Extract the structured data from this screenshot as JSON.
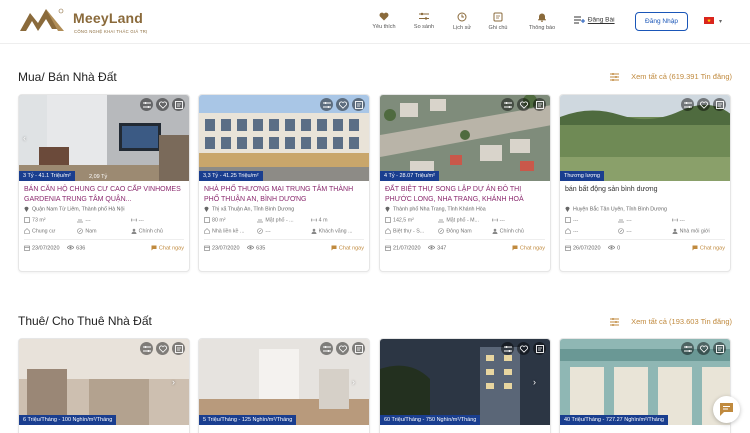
{
  "brand": {
    "name": "MeeyLand",
    "slogan": "CÔNG NGHỆ KHAI THÁC GIÁ TRỊ",
    "color": "#8a6a3b"
  },
  "nav": [
    {
      "label": "Yêu thích",
      "icon": "heart-icon"
    },
    {
      "label": "So sánh",
      "icon": "compare-icon"
    },
    {
      "label": "Lịch sử",
      "icon": "history-icon"
    },
    {
      "label": "Ghi chú",
      "icon": "note-icon"
    },
    {
      "label": "Thông báo",
      "icon": "bell-icon"
    }
  ],
  "header": {
    "post_label": "Đăng Bài",
    "login_label": "Đăng Nhập",
    "flag": "vn-flag-icon"
  },
  "sale": {
    "title": "Mua/ Bán Nhà Đất",
    "see_all": "Xem tất cả (619.391 Tin đăng)",
    "cards": [
      {
        "price": "3 Tỷ - 41.1 Triệu/m²",
        "price_extra": "2,09 Tỷ",
        "title": "BÁN CĂN HỘ CHUNG CƯ CAO CẤP VINHOMES GARDENIA TRUNG TÂM QUẬN...",
        "location": "Quận Nam Từ Liêm, Thành phố Hà Nội",
        "a1": "73 m²",
        "a2": "---",
        "a3": "---",
        "b1": "Chung cư",
        "b2": "Nam",
        "b3": "Chính chủ",
        "date": "23/07/2020",
        "views": "636",
        "chat": "Chat ngay"
      },
      {
        "price": "3,3 Tỷ - 41.25 Triệu/m²",
        "price_extra": "",
        "title": "NHÀ PHỐ THƯƠNG MẠI TRUNG TÂM THÀNH PHỐ THUẬN AN, BÌNH DƯƠNG",
        "location": "Thị xã Thuận An, Tỉnh Bình Dương",
        "a1": "80 m²",
        "a2": "Mặt phố - ...",
        "a3": "4 m",
        "b1": "Nhà liền kề ...",
        "b2": "---",
        "b3": "Khách vãng ...",
        "date": "23/07/2020",
        "views": "635",
        "chat": "Chat ngay"
      },
      {
        "price": "4 Tỷ - 28.07 Triệu/m²",
        "price_extra": "",
        "title": "ĐẤT BIỆT THỰ SONG LẬP DỰ ÁN ĐÔ THỊ PHƯỚC LONG, NHA TRANG, KHÁNH HOÀ",
        "location": "Thành phố Nha Trang, Tỉnh Khánh Hòa",
        "a1": "142,5 m²",
        "a2": "Mặt phố - M...",
        "a3": "---",
        "b1": "Biệt thự - S...",
        "b2": "Đông Nam",
        "b3": "Chính chủ",
        "date": "21/07/2020",
        "views": "347",
        "chat": "Chat ngay"
      },
      {
        "price": "Thương lượng",
        "price_extra": "",
        "title": "bán bất động sản bình dương",
        "location": "Huyện Bắc Tân Uyên, Tỉnh Bình Dương",
        "a1": "---",
        "a2": "---",
        "a3": "---",
        "b1": "---",
        "b2": "---",
        "b3": "Nhà môi giới",
        "date": "26/07/2020",
        "views": "0",
        "chat": "Chat ngay"
      }
    ]
  },
  "rent": {
    "title": "Thuê/ Cho Thuê Nhà Đất",
    "see_all": "Xem tất cả (193.603 Tin đăng)",
    "cards": [
      {
        "price": "6 Triệu/Tháng - 100 Nghìn/m²/Tháng"
      },
      {
        "price": "5 Triệu/Tháng - 125 Nghìn/m²/Tháng"
      },
      {
        "price": "60 Triệu/Tháng - 750 Nghìn/m²/Tháng"
      },
      {
        "price": "40 Triệu/Tháng - 727.27 Nghìn/m²/Tháng"
      }
    ]
  },
  "colors": {
    "accent": "#c08a3e",
    "price_tag": "#1a3e8f",
    "login": "#1a56b8",
    "title_purple": "#8a2a6e"
  }
}
